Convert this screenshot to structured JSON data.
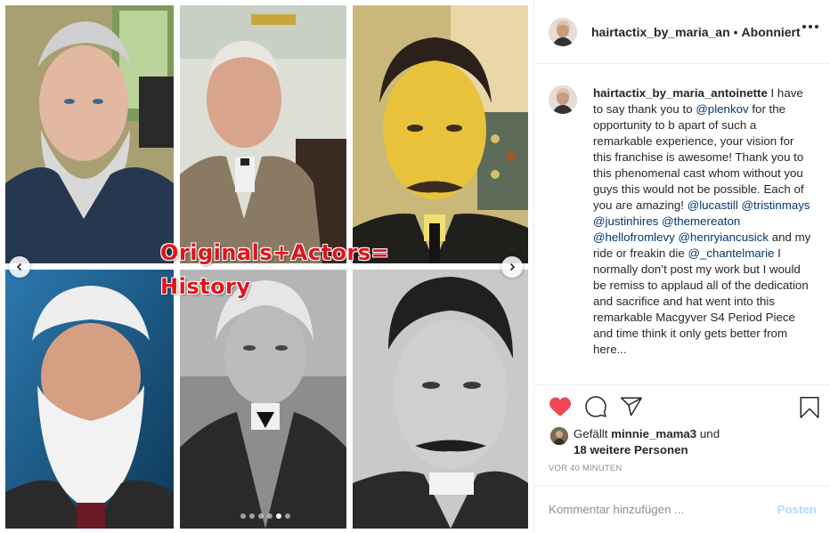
{
  "media": {
    "overlay_line1": "Originals+Actors=",
    "overlay_line2": "History",
    "carousel": {
      "total": 6,
      "current": 5
    },
    "icons": {
      "prev": "chevron-left-icon",
      "next": "chevron-right-icon"
    }
  },
  "header": {
    "username": "hairtactix_by_maria_an",
    "separator": "•",
    "follow_status": "Abonniert",
    "more_icon": "more-options-icon"
  },
  "caption": {
    "username": "hairtactix_by_maria_antoinette",
    "segments": [
      {
        "text": " I have to say thank you to ",
        "type": "text"
      },
      {
        "text": "@plenkov",
        "type": "mention"
      },
      {
        "text": " for the opportunity to b apart of such a remarkable experience, your vision for this franchise is awesome! Thank you to this phenomenal cast whom without you guys this would not be possible. Each of you are amazing! ",
        "type": "text"
      },
      {
        "text": "@lucastill",
        "type": "mention"
      },
      {
        "text": " ",
        "type": "text"
      },
      {
        "text": "@tristinmays",
        "type": "mention"
      },
      {
        "text": " ",
        "type": "text"
      },
      {
        "text": "@justinhires",
        "type": "mention"
      },
      {
        "text": " ",
        "type": "text"
      },
      {
        "text": "@themereaton",
        "type": "mention"
      },
      {
        "text": " ",
        "type": "text"
      },
      {
        "text": "@hellofromlevy",
        "type": "mention"
      },
      {
        "text": " ",
        "type": "text"
      },
      {
        "text": "@henryiancusick",
        "type": "mention"
      },
      {
        "text": " and my ride or freakin die ",
        "type": "text"
      },
      {
        "text": "@_chantelmarie",
        "type": "mention"
      },
      {
        "text": " I normally don’t post my work but I would be remiss to applaud all of the dedication and sacrifice and hat went into this remarkable Macgyver S4 Period Piece and time think it only gets better from here...",
        "type": "text"
      }
    ]
  },
  "actions": {
    "like_icon": "heart-filled-icon",
    "comment_icon": "comment-icon",
    "share_icon": "share-icon",
    "save_icon": "bookmark-icon",
    "like_color": "#ed4956"
  },
  "likes": {
    "prefix": "Gefällt ",
    "user": "minnie_mama3",
    "middle": " und",
    "others": "18 weitere Personen"
  },
  "timestamp": "VOR 40 MINUTEN",
  "comment": {
    "placeholder": "Kommentar hinzufügen ...",
    "post_label": "Posten"
  },
  "colors": {
    "link": "#00376b",
    "muted": "#8e8e8e",
    "post_disabled": "#b3dbff",
    "overlay_red": "#e0141c"
  }
}
